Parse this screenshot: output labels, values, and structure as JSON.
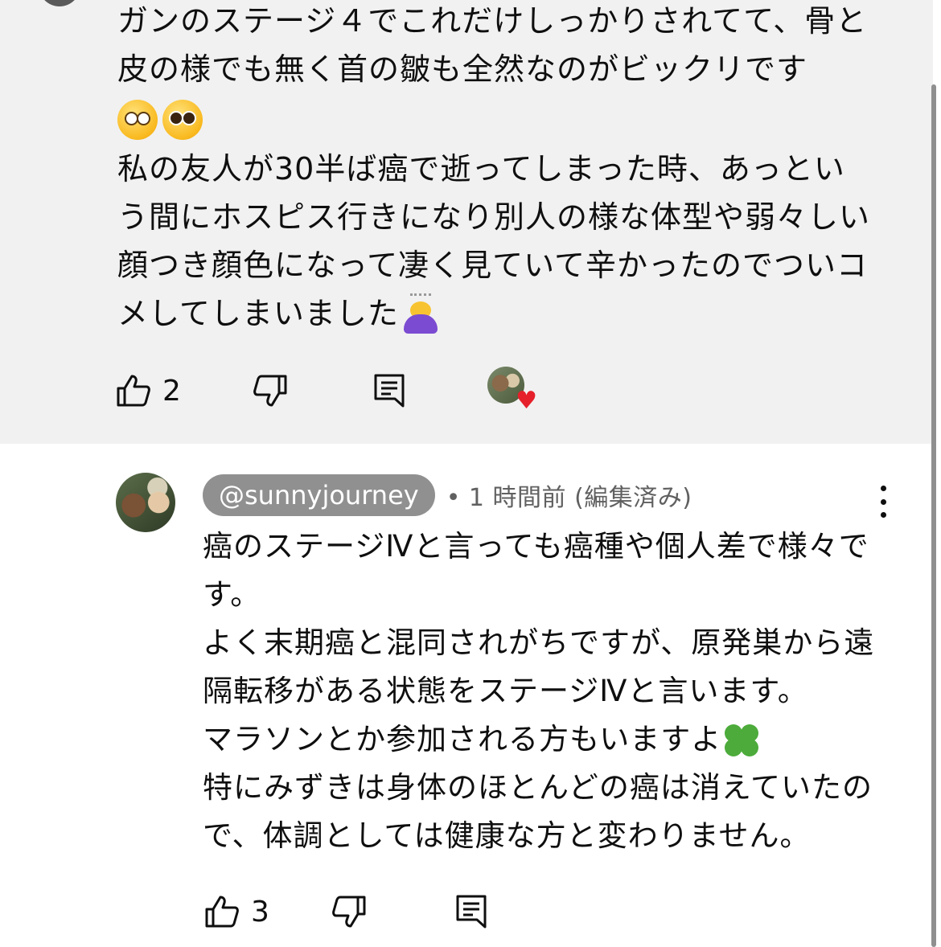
{
  "top_comment": {
    "text_line1": "ガンのステージ４でこれだけしっかりされてて、骨と皮の様でも無く首の皺も全然なのがビックリです",
    "emoji1": "flushed-face-emoji",
    "emoji2": "pleading-face-emoji",
    "text_line2": "私の友人が30半ば癌で逝ってしまった時、あっという間にホスピス行きになり別人の様な体型や弱々しい顔つき顔色になって凄く見ていて辛かったのでついコメしてしまいました",
    "emoji3": "person-bowing-emoji",
    "like_count": "2",
    "icons": {
      "like": "thumbs-up-icon",
      "dislike": "thumbs-down-icon",
      "reply": "reply-icon",
      "creator_heart": "creator-heart-icon"
    }
  },
  "reply": {
    "handle": "@sunnyjourney",
    "meta": "• 1 時間前 (編集済み)",
    "text_part1": "癌のステージⅣと言っても癌種や個人差で様々です。\nよく末期癌と混同されがちですが、原発巣から遠隔転移がある状態をステージⅣと言います。\nマラソンとか参加される方もいますよ",
    "emoji": "four-leaf-clover-emoji",
    "text_part2": "\n特にみずきは身体のほとんどの癌は消えていたので、体調としては健康な方と変わりません。",
    "like_count": "3",
    "icons": {
      "like": "thumbs-up-icon",
      "dislike": "thumbs-down-icon",
      "reply": "reply-icon",
      "more": "more-vert-icon"
    }
  }
}
